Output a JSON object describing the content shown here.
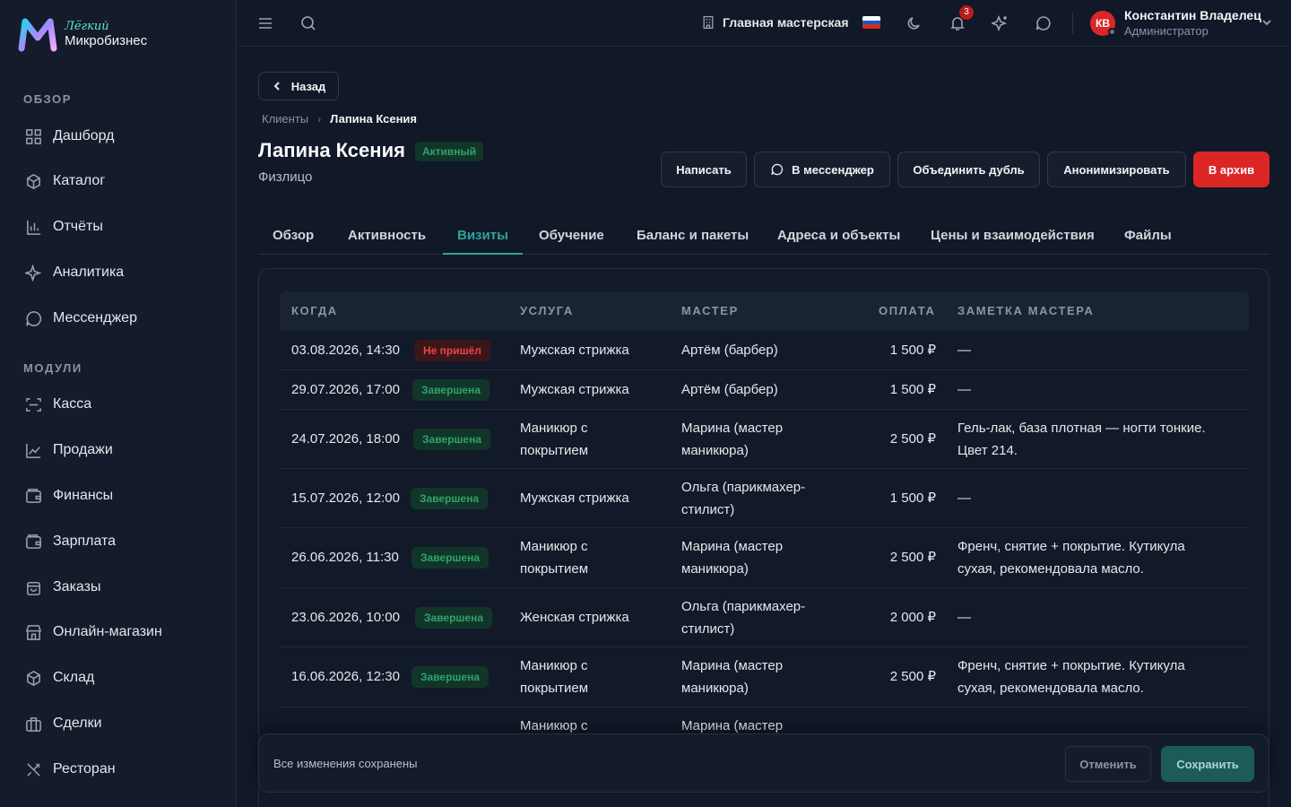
{
  "brand": {
    "top": "Лёгкий",
    "bottom": "Микробизнес"
  },
  "sidebar": {
    "section_overview": "ОБЗОР",
    "section_modules": "МОДУЛИ",
    "items": [
      {
        "label": "Дашборд",
        "icon": "dashboard-icon"
      },
      {
        "label": "Каталог",
        "icon": "catalog-icon"
      },
      {
        "label": "Отчёты",
        "icon": "reports-icon"
      },
      {
        "label": "Аналитика",
        "icon": "analytics-icon"
      },
      {
        "label": "Мессенджер",
        "icon": "messenger-icon"
      },
      {
        "label": "Касса",
        "icon": "cashbox-icon"
      },
      {
        "label": "Продажи",
        "icon": "sales-icon"
      },
      {
        "label": "Финансы",
        "icon": "finance-icon"
      },
      {
        "label": "Зарплата",
        "icon": "salary-icon"
      },
      {
        "label": "Заказы",
        "icon": "orders-icon"
      },
      {
        "label": "Онлайн-магазин",
        "icon": "store-icon"
      },
      {
        "label": "Склад",
        "icon": "warehouse-icon"
      },
      {
        "label": "Сделки",
        "icon": "deals-icon"
      },
      {
        "label": "Ресторан",
        "icon": "restaurant-icon"
      }
    ]
  },
  "topbar": {
    "workshop": "Главная мастерская",
    "notifications_count": "3",
    "user": {
      "initials": "КВ",
      "name": "Константин Владелец",
      "role": "Администратор"
    },
    "flag_colors": [
      "#ffffff",
      "#1c57c7",
      "#d52b1e"
    ]
  },
  "page": {
    "back_label": "Назад",
    "breadcrumb": {
      "parent": "Клиенты",
      "current": "Лапина Ксения"
    },
    "title": "Лапина Ксения",
    "status": "Активный",
    "subtitle": "Физлицо",
    "actions": {
      "write": "Написать",
      "messenger": "В мессенджер",
      "merge": "Объединить дубль",
      "anonymize": "Анонимизировать",
      "archive": "В архив"
    },
    "tabs": [
      "Обзор",
      "Активность",
      "Визиты",
      "Обучение",
      "Баланс и пакеты",
      "Адреса и объекты",
      "Цены и взаимодействия",
      "Файлы"
    ],
    "active_tab": "Визиты"
  },
  "visits": {
    "columns": {
      "when": "КОГДА",
      "service": "УСЛУГА",
      "master": "МАСТЕР",
      "payment": "ОПЛАТА",
      "note": "ЗАМЕТКА МАСТЕРА"
    },
    "rows": [
      {
        "when": "03.08.2026, 14:30",
        "status": "Не пришёл",
        "status_type": "bad",
        "service": "Мужская стрижка",
        "master": "Артём (барбер)",
        "payment": "1 500 ₽",
        "note": "—"
      },
      {
        "when": "29.07.2026, 17:00",
        "status": "Завершена",
        "status_type": "ok",
        "service": "Мужская стрижка",
        "master": "Артём (барбер)",
        "payment": "1 500 ₽",
        "note": "—"
      },
      {
        "when": "24.07.2026, 18:00",
        "status": "Завершена",
        "status_type": "ok",
        "service": "Маникюр с покрытием",
        "master": "Марина (мастер маникюра)",
        "payment": "2 500 ₽",
        "note": "Гель-лак, база плотная — ногти тонкие. Цвет 214."
      },
      {
        "when": "15.07.2026, 12:00",
        "status": "Завершена",
        "status_type": "ok",
        "service": "Мужская стрижка",
        "master": "Ольга (парикмахер-стилист)",
        "payment": "1 500 ₽",
        "note": "—"
      },
      {
        "when": "26.06.2026, 11:30",
        "status": "Завершена",
        "status_type": "ok",
        "service": "Маникюр с покрытием",
        "master": "Марина (мастер маникюра)",
        "payment": "2 500 ₽",
        "note": "Френч, снятие + покрытие. Кутикула сухая, рекомендовала масло."
      },
      {
        "when": "23.06.2026, 10:00",
        "status": "Завершена",
        "status_type": "ok",
        "service": "Женская стрижка",
        "master": "Ольга (парикмахер-стилист)",
        "payment": "2 000 ₽",
        "note": "—"
      },
      {
        "when": "16.06.2026, 12:30",
        "status": "Завершена",
        "status_type": "ok",
        "service": "Маникюр с покрытием",
        "master": "Марина (мастер маникюра)",
        "payment": "2 500 ₽",
        "note": "Френч, снятие + покрытие. Кутикула сухая, рекомендовала масло."
      },
      {
        "when": "",
        "status": "",
        "status_type": "ok",
        "service": "Маникюр с",
        "master": "Марина (мастер",
        "payment": "",
        "note": ""
      }
    ]
  },
  "savebar": {
    "status": "Все изменения сохранены",
    "cancel": "Отменить",
    "save": "Сохранить"
  }
}
